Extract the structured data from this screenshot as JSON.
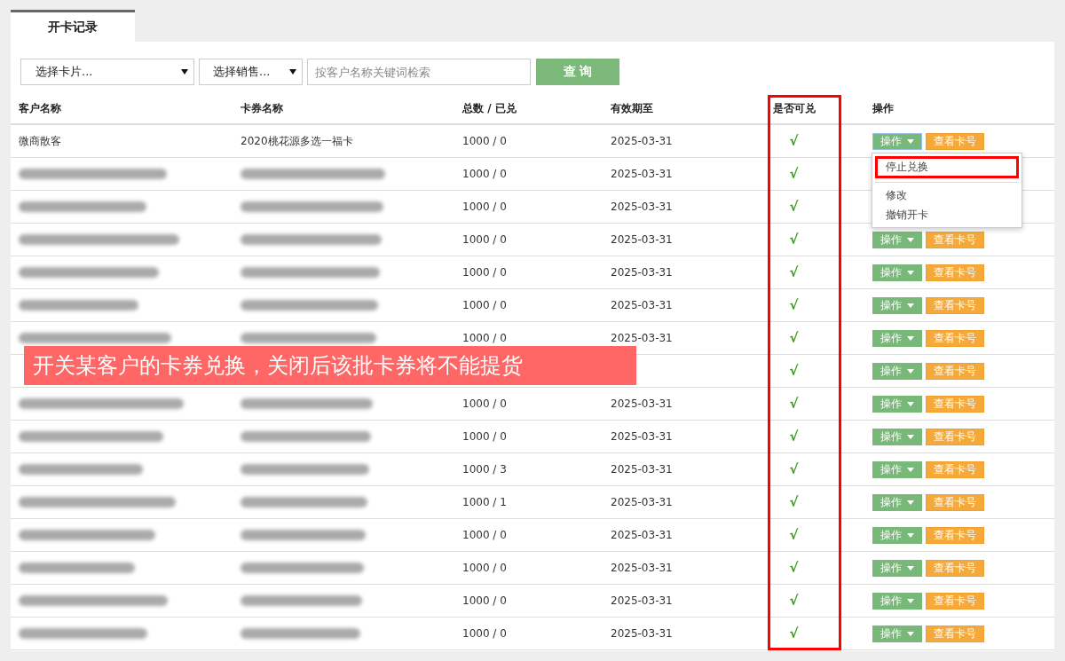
{
  "tabs": [
    {
      "label": "开卡记录",
      "selected": true
    }
  ],
  "filters": {
    "card_select": "选择卡片...",
    "seller_select": "选择销售...",
    "search_placeholder": "按客户名称关键词检索",
    "query_button": "查 询"
  },
  "table": {
    "columns": [
      {
        "label": "客户名称",
        "highlighted": false
      },
      {
        "label": "卡券名称",
        "highlighted": false
      },
      {
        "label": "总数 / 已兑",
        "highlighted": false
      },
      {
        "label": "有效期至",
        "highlighted": false
      },
      {
        "label": "是否可兑",
        "highlighted": true
      },
      {
        "label": "操作",
        "highlighted": false
      }
    ],
    "rows": [
      {
        "kind": "plain",
        "customer": "微商散客",
        "card": "2020桃花源多选一福卡",
        "totals": "1000 / 0",
        "expiry": "2025-03-31",
        "exchangeable": "√",
        "action_button": "操作",
        "view_button": "查看卡号",
        "menu_open": true
      },
      {
        "kind": "redacted",
        "totals": "1000 / 0",
        "expiry": "2025-03-31",
        "exchangeable": "√"
      },
      {
        "kind": "redacted",
        "totals": "1000 / 0",
        "expiry": "2025-03-31",
        "exchangeable": "√"
      },
      {
        "kind": "redacted",
        "totals": "1000 / 0",
        "expiry": "2025-03-31",
        "exchangeable": "√",
        "action_button": "操作",
        "view_button": "查看卡号",
        "menu_open": false
      },
      {
        "kind": "redacted",
        "totals": "1000 / 0",
        "expiry": "2025-03-31",
        "exchangeable": "√",
        "action_button": "操作",
        "view_button": "查看卡号",
        "menu_open": false
      },
      {
        "kind": "redacted",
        "totals": "1000 / 0",
        "expiry": "2025-03-31",
        "exchangeable": "√",
        "action_button": "操作",
        "view_button": "查看卡号",
        "menu_open": false
      },
      {
        "kind": "redacted",
        "totals": "1000 / 0",
        "expiry": "2025-03-31",
        "exchangeable": "√",
        "action_button": "操作",
        "view_button": "查看卡号",
        "menu_open": false
      },
      {
        "kind": "covered",
        "exchangeable": "√",
        "action_button": "操作",
        "view_button": "查看卡号",
        "menu_open": false
      },
      {
        "kind": "redacted",
        "totals": "1000 / 0",
        "expiry": "2025-03-31",
        "exchangeable": "√",
        "action_button": "操作",
        "view_button": "查看卡号",
        "menu_open": false
      },
      {
        "kind": "redacted",
        "totals": "1000 / 0",
        "expiry": "2025-03-31",
        "exchangeable": "√",
        "action_button": "操作",
        "view_button": "查看卡号",
        "menu_open": false
      },
      {
        "kind": "redacted",
        "totals": "1000 / 3",
        "expiry": "2025-03-31",
        "exchangeable": "√",
        "action_button": "操作",
        "view_button": "查看卡号",
        "menu_open": false
      },
      {
        "kind": "redacted",
        "totals": "1000 / 1",
        "expiry": "2025-03-31",
        "exchangeable": "√",
        "action_button": "操作",
        "view_button": "查看卡号",
        "menu_open": false
      },
      {
        "kind": "redacted",
        "totals": "1000 / 0",
        "expiry": "2025-03-31",
        "exchangeable": "√",
        "action_button": "操作",
        "view_button": "查看卡号",
        "menu_open": false
      },
      {
        "kind": "redacted",
        "totals": "1000 / 0",
        "expiry": "2025-03-31",
        "exchangeable": "√",
        "action_button": "操作",
        "view_button": "查看卡号",
        "menu_open": false
      },
      {
        "kind": "redacted",
        "totals": "1000 / 0",
        "expiry": "2025-03-31",
        "exchangeable": "√",
        "action_button": "操作",
        "view_button": "查看卡号",
        "menu_open": false
      },
      {
        "kind": "redacted",
        "totals": "1000 / 0",
        "expiry": "2025-03-31",
        "exchangeable": "√",
        "action_button": "操作",
        "view_button": "查看卡号",
        "menu_open": false
      }
    ]
  },
  "dropdown_menu": {
    "items": [
      {
        "label": "停止兑换",
        "highlighted": true
      },
      {
        "label": "修改",
        "highlighted": false
      },
      {
        "label": "撤销开卡",
        "highlighted": false
      }
    ]
  },
  "annotation": "开关某客户的卡券兑换，关闭后该批卡券将不能提货"
}
